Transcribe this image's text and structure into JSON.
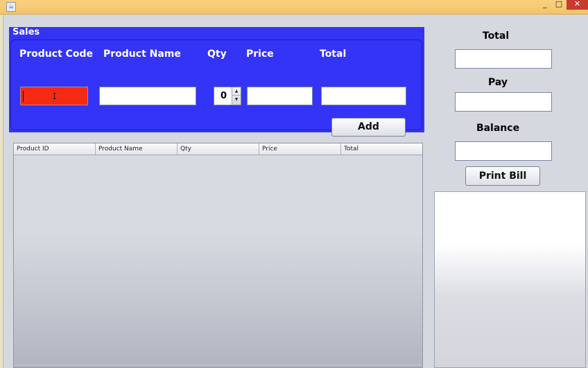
{
  "window": {
    "min_glyph": "_",
    "max_glyph": "□",
    "close_glyph": "✕",
    "icon": "java-cup-icon"
  },
  "sales": {
    "title": "Sales",
    "labels": {
      "product_code": "Product Code",
      "product_name": "Product Name",
      "qty": "Qty",
      "price": "Price",
      "total": "Total"
    },
    "product_code_value": "",
    "product_name_value": "",
    "qty_value": "0",
    "price_value": "",
    "total_value": "",
    "add_label": "Add"
  },
  "table": {
    "columns": [
      "Product ID",
      "Product Name",
      "Qty",
      "Price",
      "Total"
    ],
    "rows": []
  },
  "summary": {
    "total_label": "Total",
    "total_value": "",
    "pay_label": "Pay",
    "pay_value": "",
    "balance_label": "Balance",
    "balance_value": "",
    "print_label": "Print Bill"
  },
  "bill_text": "",
  "colors": {
    "sales_panel": "#3434f6",
    "product_code_field": "#f42a12",
    "titlebar": "#f5c76f"
  }
}
